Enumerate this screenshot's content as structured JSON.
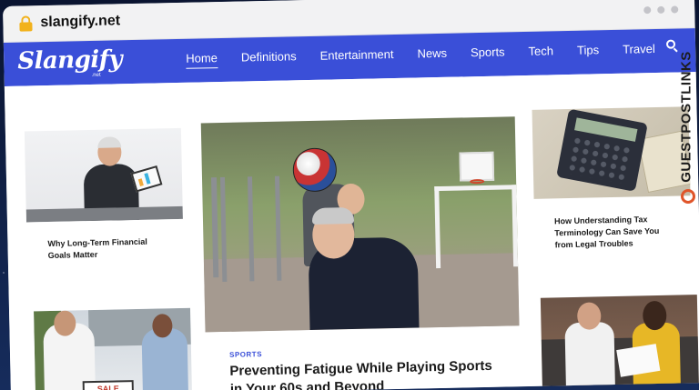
{
  "browser": {
    "url": "slangify.net"
  },
  "site": {
    "logo": "Slangify",
    "logo_sub": ".net"
  },
  "nav": {
    "items": [
      {
        "label": "Home",
        "active": true
      },
      {
        "label": "Definitions",
        "active": false
      },
      {
        "label": "Entertainment",
        "active": false
      },
      {
        "label": "News",
        "active": false
      },
      {
        "label": "Sports",
        "active": false
      },
      {
        "label": "Tech",
        "active": false
      },
      {
        "label": "Tips",
        "active": false
      },
      {
        "label": "Travel",
        "active": false
      }
    ],
    "search_icon": "search-icon"
  },
  "articles": {
    "left_top": {
      "title": "Why Long-Term Financial Goals Matter"
    },
    "hero": {
      "tag": "SPORTS",
      "title": "Preventing Fatigue While Playing Sports in Your 60s and Beyond"
    },
    "right_top": {
      "title": "How Understanding Tax Terminology Can Save You from Legal Troubles"
    },
    "left_bottom": {
      "sign": "SALE"
    }
  },
  "watermark": {
    "text": "GUESTPOSTLINKS"
  },
  "colors": {
    "brand": "#3a4fd8",
    "lock": "#f2b21c",
    "watermark_logo": "#e0552a"
  }
}
